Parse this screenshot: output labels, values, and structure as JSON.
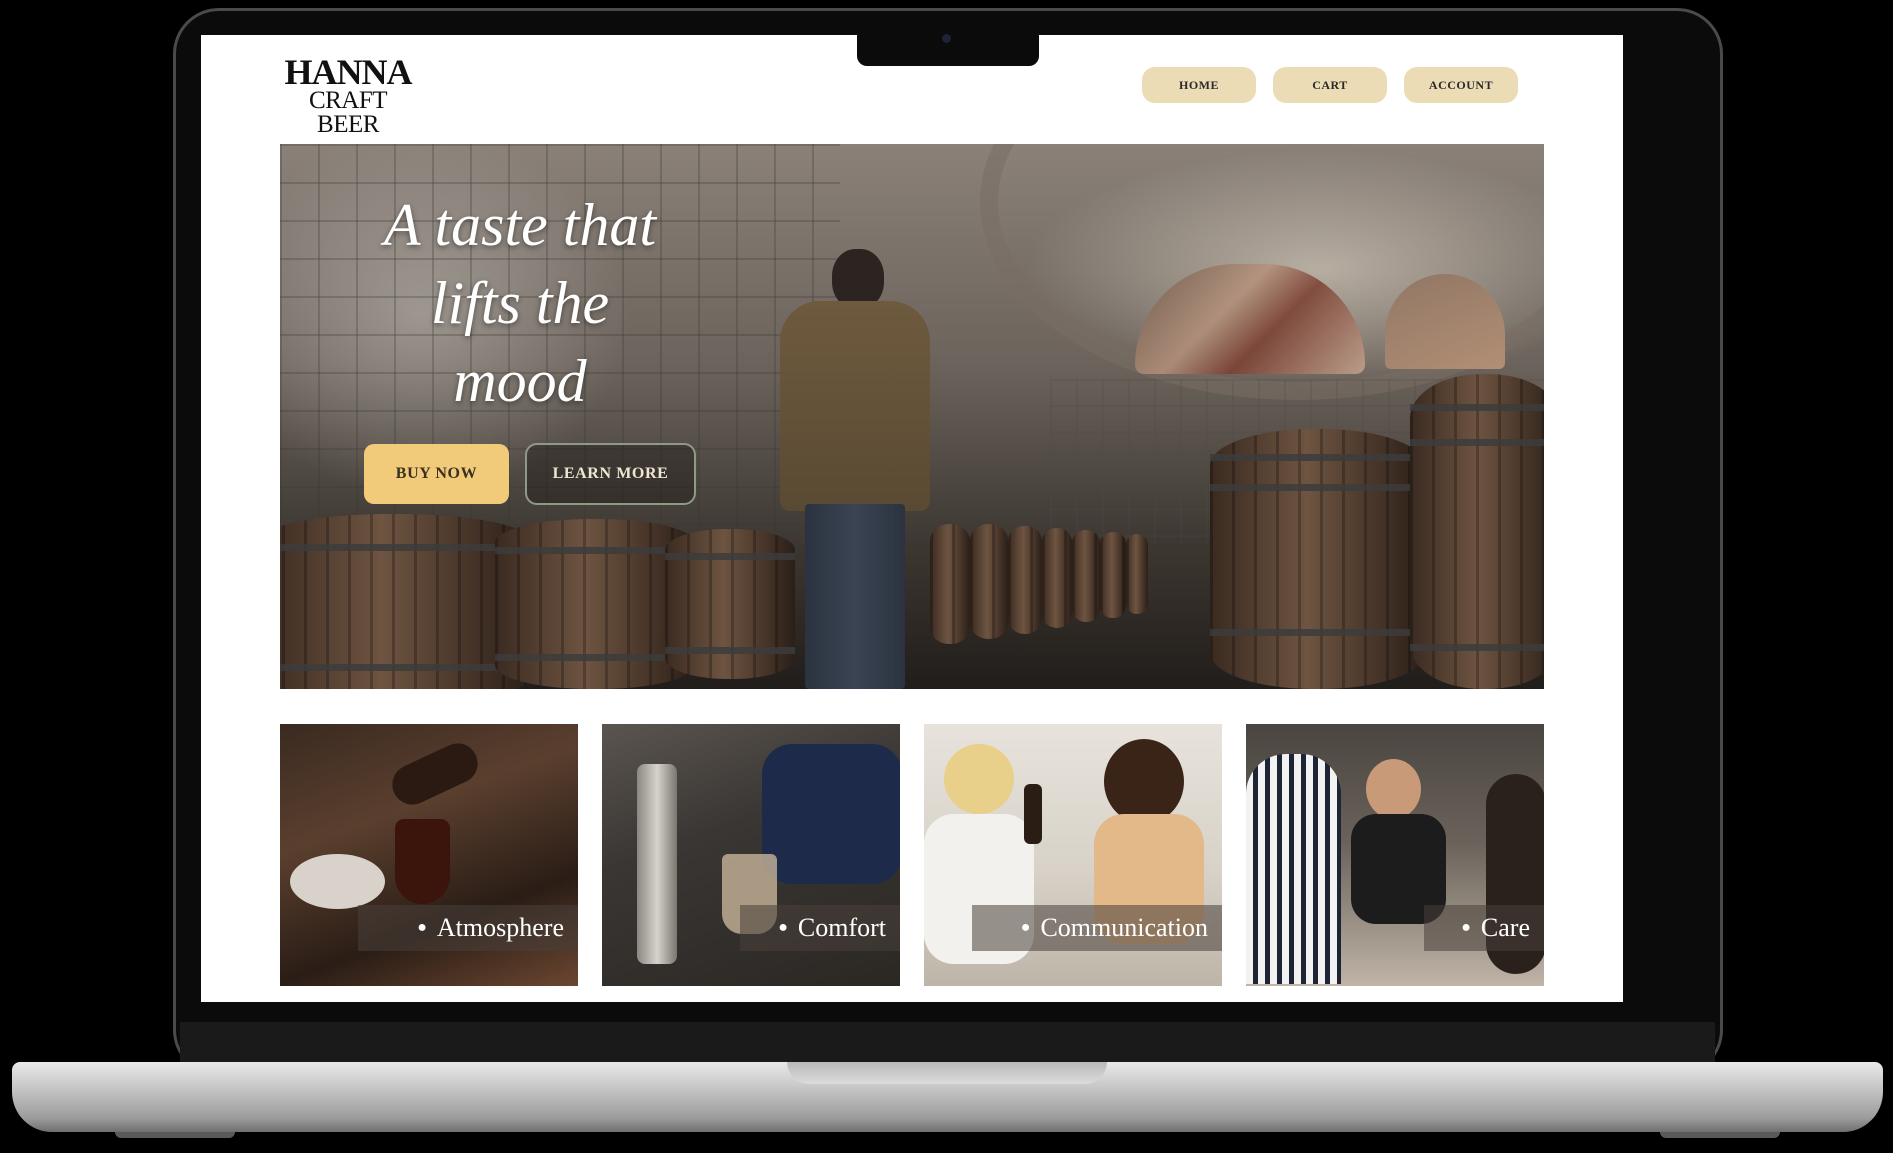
{
  "brand": {
    "line1": "HANNA",
    "line2": "CRAFT BEER"
  },
  "nav": {
    "home": "HOME",
    "cart": "CART",
    "account": "ACCOUNT"
  },
  "hero": {
    "line1": "A taste that",
    "line2": "lifts the",
    "line3": "mood",
    "buy_label": "BUY NOW",
    "learn_label": "LEARN MORE"
  },
  "features": [
    {
      "label": "Atmosphere",
      "bullet": "●"
    },
    {
      "label": "Comfort",
      "bullet": "●"
    },
    {
      "label": "Communication",
      "bullet": "●"
    },
    {
      "label": "Care",
      "bullet": "●"
    }
  ],
  "colors": {
    "nav_button": "#ecdcb6",
    "buy_button": "#f2cb7a",
    "learn_border": "#8e9a86",
    "page_bg": "#ffffff"
  }
}
